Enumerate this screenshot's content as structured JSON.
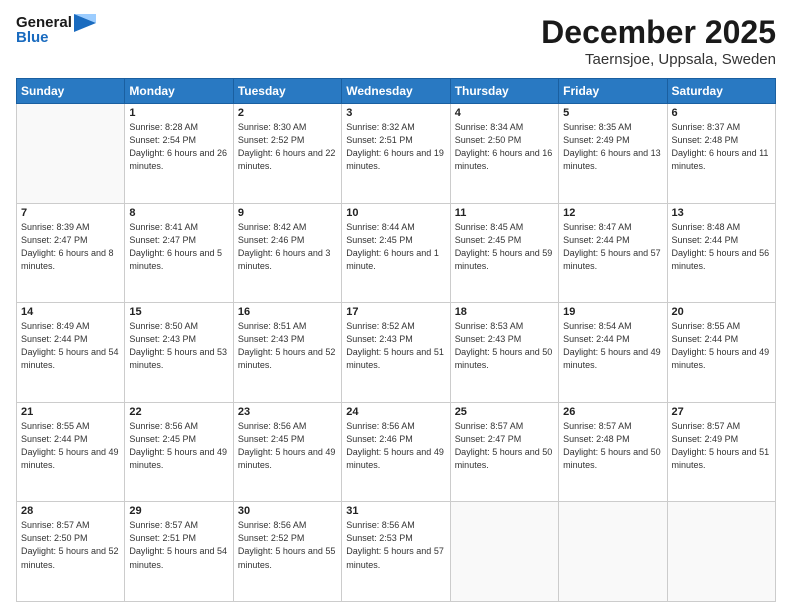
{
  "header": {
    "logo_text_general": "General",
    "logo_text_blue": "Blue",
    "main_title": "December 2025",
    "subtitle": "Taernsjoe, Uppsala, Sweden"
  },
  "days_of_week": [
    "Sunday",
    "Monday",
    "Tuesday",
    "Wednesday",
    "Thursday",
    "Friday",
    "Saturday"
  ],
  "weeks": [
    [
      {
        "day": "",
        "info": ""
      },
      {
        "day": "1",
        "info": "Sunrise: 8:28 AM\nSunset: 2:54 PM\nDaylight: 6 hours and 26 minutes."
      },
      {
        "day": "2",
        "info": "Sunrise: 8:30 AM\nSunset: 2:52 PM\nDaylight: 6 hours and 22 minutes."
      },
      {
        "day": "3",
        "info": "Sunrise: 8:32 AM\nSunset: 2:51 PM\nDaylight: 6 hours and 19 minutes."
      },
      {
        "day": "4",
        "info": "Sunrise: 8:34 AM\nSunset: 2:50 PM\nDaylight: 6 hours and 16 minutes."
      },
      {
        "day": "5",
        "info": "Sunrise: 8:35 AM\nSunset: 2:49 PM\nDaylight: 6 hours and 13 minutes."
      },
      {
        "day": "6",
        "info": "Sunrise: 8:37 AM\nSunset: 2:48 PM\nDaylight: 6 hours and 11 minutes."
      }
    ],
    [
      {
        "day": "7",
        "info": "Sunrise: 8:39 AM\nSunset: 2:47 PM\nDaylight: 6 hours and 8 minutes."
      },
      {
        "day": "8",
        "info": "Sunrise: 8:41 AM\nSunset: 2:47 PM\nDaylight: 6 hours and 5 minutes."
      },
      {
        "day": "9",
        "info": "Sunrise: 8:42 AM\nSunset: 2:46 PM\nDaylight: 6 hours and 3 minutes."
      },
      {
        "day": "10",
        "info": "Sunrise: 8:44 AM\nSunset: 2:45 PM\nDaylight: 6 hours and 1 minute."
      },
      {
        "day": "11",
        "info": "Sunrise: 8:45 AM\nSunset: 2:45 PM\nDaylight: 5 hours and 59 minutes."
      },
      {
        "day": "12",
        "info": "Sunrise: 8:47 AM\nSunset: 2:44 PM\nDaylight: 5 hours and 57 minutes."
      },
      {
        "day": "13",
        "info": "Sunrise: 8:48 AM\nSunset: 2:44 PM\nDaylight: 5 hours and 56 minutes."
      }
    ],
    [
      {
        "day": "14",
        "info": "Sunrise: 8:49 AM\nSunset: 2:44 PM\nDaylight: 5 hours and 54 minutes."
      },
      {
        "day": "15",
        "info": "Sunrise: 8:50 AM\nSunset: 2:43 PM\nDaylight: 5 hours and 53 minutes."
      },
      {
        "day": "16",
        "info": "Sunrise: 8:51 AM\nSunset: 2:43 PM\nDaylight: 5 hours and 52 minutes."
      },
      {
        "day": "17",
        "info": "Sunrise: 8:52 AM\nSunset: 2:43 PM\nDaylight: 5 hours and 51 minutes."
      },
      {
        "day": "18",
        "info": "Sunrise: 8:53 AM\nSunset: 2:43 PM\nDaylight: 5 hours and 50 minutes."
      },
      {
        "day": "19",
        "info": "Sunrise: 8:54 AM\nSunset: 2:44 PM\nDaylight: 5 hours and 49 minutes."
      },
      {
        "day": "20",
        "info": "Sunrise: 8:55 AM\nSunset: 2:44 PM\nDaylight: 5 hours and 49 minutes."
      }
    ],
    [
      {
        "day": "21",
        "info": "Sunrise: 8:55 AM\nSunset: 2:44 PM\nDaylight: 5 hours and 49 minutes."
      },
      {
        "day": "22",
        "info": "Sunrise: 8:56 AM\nSunset: 2:45 PM\nDaylight: 5 hours and 49 minutes."
      },
      {
        "day": "23",
        "info": "Sunrise: 8:56 AM\nSunset: 2:45 PM\nDaylight: 5 hours and 49 minutes."
      },
      {
        "day": "24",
        "info": "Sunrise: 8:56 AM\nSunset: 2:46 PM\nDaylight: 5 hours and 49 minutes."
      },
      {
        "day": "25",
        "info": "Sunrise: 8:57 AM\nSunset: 2:47 PM\nDaylight: 5 hours and 50 minutes."
      },
      {
        "day": "26",
        "info": "Sunrise: 8:57 AM\nSunset: 2:48 PM\nDaylight: 5 hours and 50 minutes."
      },
      {
        "day": "27",
        "info": "Sunrise: 8:57 AM\nSunset: 2:49 PM\nDaylight: 5 hours and 51 minutes."
      }
    ],
    [
      {
        "day": "28",
        "info": "Sunrise: 8:57 AM\nSunset: 2:50 PM\nDaylight: 5 hours and 52 minutes."
      },
      {
        "day": "29",
        "info": "Sunrise: 8:57 AM\nSunset: 2:51 PM\nDaylight: 5 hours and 54 minutes."
      },
      {
        "day": "30",
        "info": "Sunrise: 8:56 AM\nSunset: 2:52 PM\nDaylight: 5 hours and 55 minutes."
      },
      {
        "day": "31",
        "info": "Sunrise: 8:56 AM\nSunset: 2:53 PM\nDaylight: 5 hours and 57 minutes."
      },
      {
        "day": "",
        "info": ""
      },
      {
        "day": "",
        "info": ""
      },
      {
        "day": "",
        "info": ""
      }
    ]
  ]
}
